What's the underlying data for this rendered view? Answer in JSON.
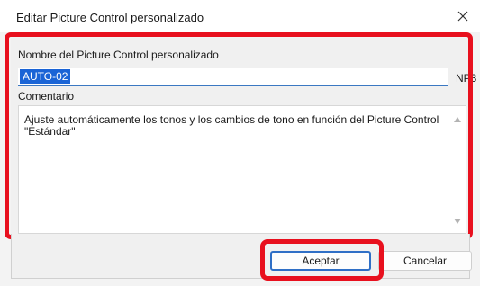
{
  "window": {
    "title": "Editar Picture Control personalizado",
    "close_icon": "close-icon"
  },
  "form": {
    "name_label": "Nombre del Picture Control personalizado",
    "name_value": "AUTO-02",
    "name_suffix": "NP3",
    "comment_label": "Comentario",
    "comment_value": "Ajuste automáticamente los tonos y los cambios de tono en función del Picture Control\n\"Estándar\""
  },
  "buttons": {
    "accept_label": "Aceptar",
    "cancel_label": "Cancelar"
  },
  "colors": {
    "highlight": "#e8101e",
    "selection": "#1a64d6"
  }
}
